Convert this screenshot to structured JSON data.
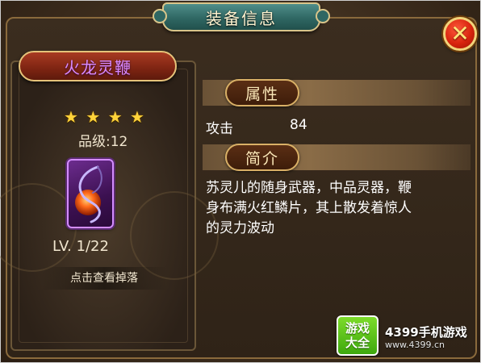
{
  "window": {
    "title": "装备信息",
    "close_icon": "close-x-icon"
  },
  "item": {
    "name": "火龙灵鞭",
    "stars": 4,
    "star_icon": "star-icon",
    "grade_label": "品级:12",
    "icon": "fire-whip-icon",
    "level_label": "LV. 1/22",
    "view_drop_label": "点击查看掉落"
  },
  "attributes": {
    "header": "属性",
    "rows": [
      {
        "name": "攻击",
        "value": "84"
      }
    ]
  },
  "intro": {
    "header": "简介",
    "lines": [
      "苏灵儿的随身武器，中品灵器，鞭",
      "身布满火红鳞片，其上散发着惊人",
      "的灵力波动"
    ]
  },
  "watermark": {
    "badge_top": "游戏",
    "badge_bottom": "大全",
    "name": "4399手机游戏",
    "url": "www.4399.cn"
  },
  "colors": {
    "item_name": "#d98aff",
    "title_tab": "#2f6763",
    "close_button": "#d8240e",
    "star": "#ffd33a"
  }
}
